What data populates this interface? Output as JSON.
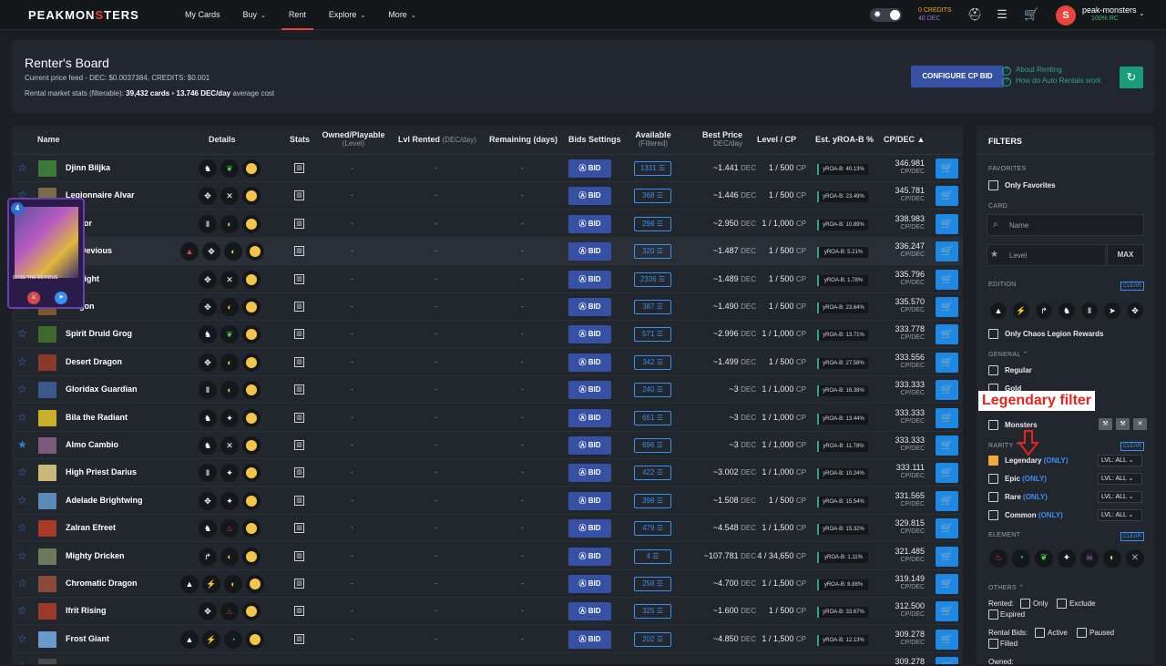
{
  "topbar": {
    "logo_a": "PEAKMON",
    "logo_b": "S",
    "logo_c": "TERS",
    "nav": [
      {
        "label": "My Cards",
        "caret": false,
        "active": false
      },
      {
        "label": "Buy",
        "caret": true,
        "active": false
      },
      {
        "label": "Rent",
        "caret": false,
        "active": true
      },
      {
        "label": "Explore",
        "caret": true,
        "active": false
      },
      {
        "label": "More",
        "caret": true,
        "active": false
      }
    ],
    "credits": "0 CREDITS",
    "dec": "40 DEC",
    "username": "peak-monsters",
    "rc": "100% RC"
  },
  "board": {
    "title": "Renter's Board",
    "price_feed": "Current price feed - DEC: $0.0037384, CREDITS: $0.001",
    "stats_prefix": "Rental market stats (filterable):",
    "cards": "39,432 cards",
    "dot": "•",
    "avg": "13.746 DEC/day",
    "avg_suffix": "average cost",
    "configure_btn": "CONFIGURE CP BID",
    "link1": "About Renting",
    "link2": "How do Auto Rentals work"
  },
  "table": {
    "headers": {
      "name": "Name",
      "details": "Details",
      "stats": "Stats",
      "owned": "Owned/Playable",
      "owned_sub": "(Level)",
      "lvl_rented": "Lvl Rented",
      "lvl_rented_sub": "(DEC/day)",
      "remaining": "Remaining (days)",
      "bids": "Bids Settings",
      "available": "Available",
      "available_sub": "(Filtered)",
      "best_price": "Best Price",
      "best_price_sub": "DEC/day",
      "level": "Level / CP",
      "yroa": "Est. yROA-B %",
      "cpdec": "CP/DEC"
    },
    "bid_label": "BID",
    "dash": "-",
    "rows": [
      {
        "name": "Djinn Biljka",
        "icons": [
          "♞",
          "❦",
          "●"
        ],
        "avail": "1331",
        "price": "~1.441",
        "lvl": "1 / 500",
        "yroa": "yROA-B: 40.13%",
        "cp": "346.981",
        "starred": false,
        "color": "#3d7a3a"
      },
      {
        "name": "Legionnaire Alvar",
        "icons": [
          "✥",
          "✕",
          "●"
        ],
        "avail": "368",
        "price": "~1.446",
        "lvl": "1 / 500",
        "yroa": "yROA-B: 23.49%",
        "cp": "345.781",
        "starred": false,
        "color": "#7a6b4a"
      },
      {
        "name": "Doctor",
        "icons": [
          "Ⅱ",
          "◐",
          "●"
        ],
        "avail": "298",
        "price": "~2.950",
        "lvl": "1 / 1,000",
        "yroa": "yROA-B: 10.89%",
        "cp": "338.983",
        "starred": false,
        "color": "#6a4a7a"
      },
      {
        "name": "the Devious",
        "icons": [
          "▲",
          "✥",
          "◐",
          "●"
        ],
        "avail": "320",
        "price": "~1.487",
        "lvl": "1 / 500",
        "yroa": "yROA-B: 5.21%",
        "cp": "336.247",
        "starred": false,
        "color": "#5a3a8a"
      },
      {
        "name": "or Blight",
        "icons": [
          "✥",
          "✕",
          "●"
        ],
        "avail": "2336",
        "price": "~1.489",
        "lvl": "1 / 500",
        "yroa": "yROA-B: 1.78%",
        "cp": "335.796",
        "starred": false,
        "color": "#4a5a3a"
      },
      {
        "name": "Dragon",
        "icons": [
          "✥",
          "◐",
          "●"
        ],
        "avail": "387",
        "price": "~1.490",
        "lvl": "1 / 500",
        "yroa": "yROA-B: 23.64%",
        "cp": "335.570",
        "starred": false,
        "color": "#7a5a2a"
      },
      {
        "name": "Spirit Druid Grog",
        "icons": [
          "♞",
          "❦",
          "●"
        ],
        "avail": "571",
        "price": "~2.996",
        "lvl": "1 / 1,000",
        "yroa": "yROA-B: 13.71%",
        "cp": "333.778",
        "starred": false,
        "color": "#3d6a2a"
      },
      {
        "name": "Desert Dragon",
        "icons": [
          "✥",
          "◐",
          "●"
        ],
        "avail": "342",
        "price": "~1.499",
        "lvl": "1 / 500",
        "yroa": "yROA-B: 27.58%",
        "cp": "333.556",
        "starred": false,
        "color": "#8a3a2a"
      },
      {
        "name": "Gloridax Guardian",
        "icons": [
          "Ⅱ",
          "◐",
          "●"
        ],
        "avail": "240",
        "price": "~3",
        "lvl": "1 / 1,000",
        "yroa": "yROA-B: 16.38%",
        "cp": "333.333",
        "starred": false,
        "color": "#3a5a8a"
      },
      {
        "name": "Bila the Radiant",
        "icons": [
          "♞",
          "✦",
          "●"
        ],
        "avail": "651",
        "price": "~3",
        "lvl": "1 / 1,000",
        "yroa": "yROA-B: 13.44%",
        "cp": "333.333",
        "starred": false,
        "color": "#c8b02a"
      },
      {
        "name": "Almo Cambio",
        "icons": [
          "♞",
          "✕",
          "●"
        ],
        "avail": "696",
        "price": "~3",
        "lvl": "1 / 1,000",
        "yroa": "yROA-B: 11.78%",
        "cp": "333.333",
        "starred": true,
        "color": "#7a5a7a"
      },
      {
        "name": "High Priest Darius",
        "icons": [
          "Ⅱ",
          "✦",
          "●"
        ],
        "avail": "422",
        "price": "~3.002",
        "lvl": "1 / 1,000",
        "yroa": "yROA-B: 10.24%",
        "cp": "333.111",
        "starred": false,
        "color": "#c8b87a"
      },
      {
        "name": "Adelade Brightwing",
        "icons": [
          "✥",
          "✦",
          "●"
        ],
        "avail": "398",
        "price": "~1.508",
        "lvl": "1 / 500",
        "yroa": "yROA-B: 15.54%",
        "cp": "331.565",
        "starred": false,
        "color": "#5a8aba"
      },
      {
        "name": "Zalran Efreet",
        "icons": [
          "♞",
          "♨",
          "●"
        ],
        "avail": "479",
        "price": "~4.548",
        "lvl": "1 / 1,500",
        "yroa": "yROA-B: 15.32%",
        "cp": "329.815",
        "starred": false,
        "color": "#a83a2a"
      },
      {
        "name": "Mighty Dricken",
        "icons": [
          "↱",
          "◐",
          "●"
        ],
        "avail": "4",
        "price": "~107.781",
        "lvl": "4 / 34,650",
        "yroa": "yROA-B: 1.11%",
        "cp": "321.485",
        "starred": false,
        "color": "#6a7a5a"
      },
      {
        "name": "Chromatic Dragon",
        "icons": [
          "▲",
          "⚡",
          "◐",
          "●"
        ],
        "avail": "258",
        "price": "~4.700",
        "lvl": "1 / 1,500",
        "yroa": "yROA-B: 8.88%",
        "cp": "319.149",
        "starred": false,
        "color": "#8a4a3a"
      },
      {
        "name": "Ifrit Rising",
        "icons": [
          "✥",
          "♨",
          "●"
        ],
        "avail": "325",
        "price": "~1.600",
        "lvl": "1 / 500",
        "yroa": "yROA-B: 33.67%",
        "cp": "312.500",
        "starred": false,
        "color": "#9a3a2a"
      },
      {
        "name": "Frost Giant",
        "icons": [
          "▲",
          "⚡",
          "◔",
          "●"
        ],
        "avail": "202",
        "price": "~4.850",
        "lvl": "1 / 1,500",
        "yroa": "yROA-B: 12.13%",
        "cp": "309.278",
        "starred": false,
        "color": "#6a9aca"
      },
      {
        "name": "",
        "icons": [],
        "avail": "",
        "price": "",
        "lvl": "",
        "yroa": "",
        "cp": "309.278",
        "starred": false,
        "color": "#4a4a4a"
      }
    ],
    "unit_dec": "DEC",
    "unit_cp": "CP",
    "unit_cpdec": "CP/DEC"
  },
  "popup_card": {
    "mana": "4",
    "name": "GUSE THE DEVIOUS"
  },
  "filters": {
    "title": "FILTERS",
    "favorites": "FAVORITES",
    "only_favorites": "Only Favorites",
    "card": "CARD",
    "name_placeholder": "Name",
    "level_placeholder": "Level",
    "max": "MAX",
    "edition": "EDITION",
    "clear": "CLEAR",
    "only_chaos": "Only Chaos Legion Rewards",
    "general": "GENERAL",
    "regular": "Regular",
    "gold": "Gold",
    "monsters": "Monsters",
    "rarity": "RARITY",
    "rarities": [
      {
        "label": "Legendary",
        "checked": true
      },
      {
        "label": "Epic",
        "checked": false
      },
      {
        "label": "Rare",
        "checked": false
      },
      {
        "label": "Common",
        "checked": false
      }
    ],
    "only_tag": "(ONLY)",
    "lvl_all": "LVL: ALL",
    "element": "ELEMENT",
    "others": "OTHERS",
    "rented": "Rented:",
    "only": "Only",
    "exclude": "Exclude",
    "expired": "Expired",
    "rental_bids": "Rental Bids:",
    "active": "Active",
    "paused": "Paused",
    "filled": "Filled",
    "owned": "Owned:"
  },
  "annotation": {
    "text": "Legendary filter",
    "color": "#e8241c"
  }
}
